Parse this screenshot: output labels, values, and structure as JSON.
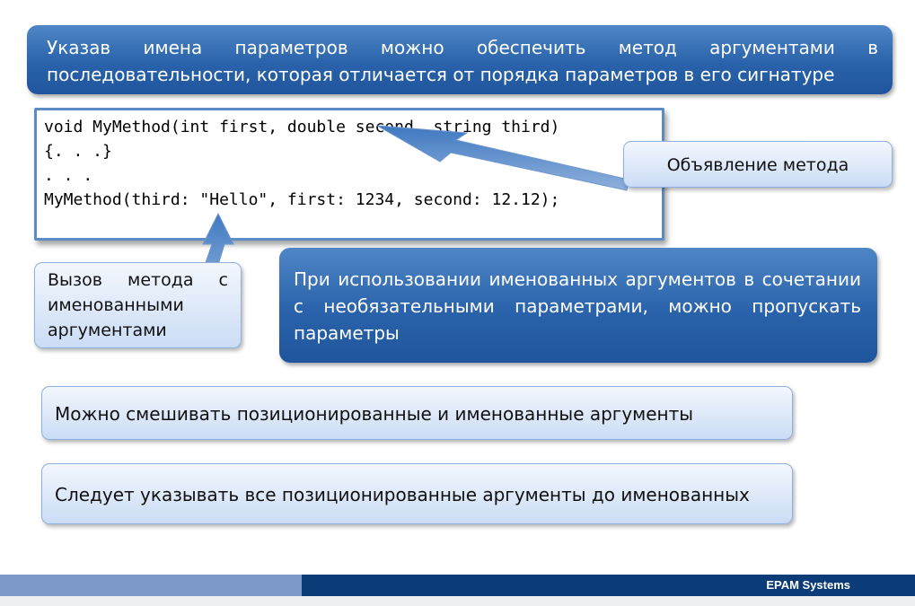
{
  "top_banner": {
    "text": "Указав имена параметров можно обеспечить метод аргументами в последовательности, которая отличается от порядка параметров в его сигнатуре"
  },
  "code": {
    "lines": [
      "void MyMethod(int first, double second, string third)",
      "{. . .}",
      ". . .",
      "MyMethod(third: \"Hello\", first: 1234, second: 12.12);"
    ]
  },
  "callouts": {
    "declaration": "Объявление метода",
    "call": "Вызов метода с именованными аргументами"
  },
  "optional_banner": {
    "text": "При использовании именованных аргументов в сочетании с необязательными параметрами, можно пропускать параметры"
  },
  "rules": {
    "mix": "Можно смешивать позиционированные и именованные аргументы",
    "order": "Следует указывать все позиционированные аргументы до именованных"
  },
  "footer": {
    "company": "EPAM Systems"
  },
  "colors": {
    "banner_dark": "#2a63ab",
    "banner_light": "#dbe7f8",
    "footer_dark": "#0c3c78",
    "footer_light": "#7c99c9"
  }
}
